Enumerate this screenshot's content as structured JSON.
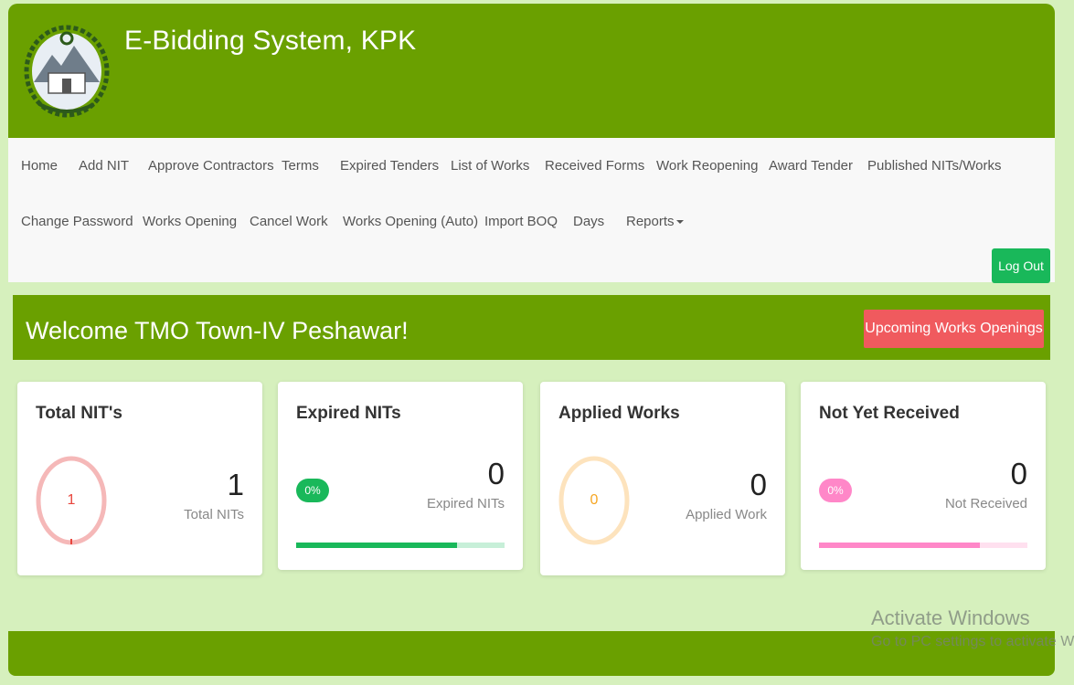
{
  "header": {
    "title": "E-Bidding System, KPK"
  },
  "nav": {
    "row1": [
      "Home",
      "Add NIT",
      "Approve Contractors",
      "Terms",
      "Expired Tenders",
      "List of Works",
      "Received Forms",
      "Work Reopening",
      "Award Tender",
      "Published NITs/Works"
    ],
    "row2": [
      "Change Password",
      "Works Opening",
      "Cancel Work",
      "Works Opening (Auto)",
      "Import BOQ",
      "Days",
      "Reports"
    ],
    "logout_label": "Log Out"
  },
  "welcome": {
    "text": "Welcome TMO Town-IV Peshawar!",
    "upcoming_label": "Upcoming Works Openings"
  },
  "cards": [
    {
      "title": "Total NIT's",
      "ring_value": "1",
      "value": "1",
      "label": "Total NITs",
      "ring_color": "#f5b8b8",
      "text_color": "#e8453c"
    },
    {
      "title": "Expired NITs",
      "pill": "0%",
      "value": "0",
      "label": "Expired NITs",
      "pill_color": "#19b85a",
      "bar_color": "#19b85a",
      "bar_track": "#c7efd8",
      "bar_fill": 0.77
    },
    {
      "title": "Applied Works",
      "ring_value": "0",
      "value": "0",
      "label": "Applied Work",
      "ring_color": "#fde3bd",
      "text_color": "#f6a623"
    },
    {
      "title": "Not Yet Received",
      "pill": "0%",
      "value": "0",
      "label": "Not Received",
      "pill_color": "#ff87c8",
      "bar_color": "#ff87c8",
      "bar_track": "#ffe0ef",
      "bar_fill": 0.77
    }
  ],
  "watermark": {
    "line1": "Activate Windows",
    "line2": "Go to PC settings to activate Windows."
  },
  "colors": {
    "brand_green": "#6aa000",
    "page_bg": "#d6f0bd",
    "danger": "#f05a5e",
    "success": "#19b85a"
  }
}
